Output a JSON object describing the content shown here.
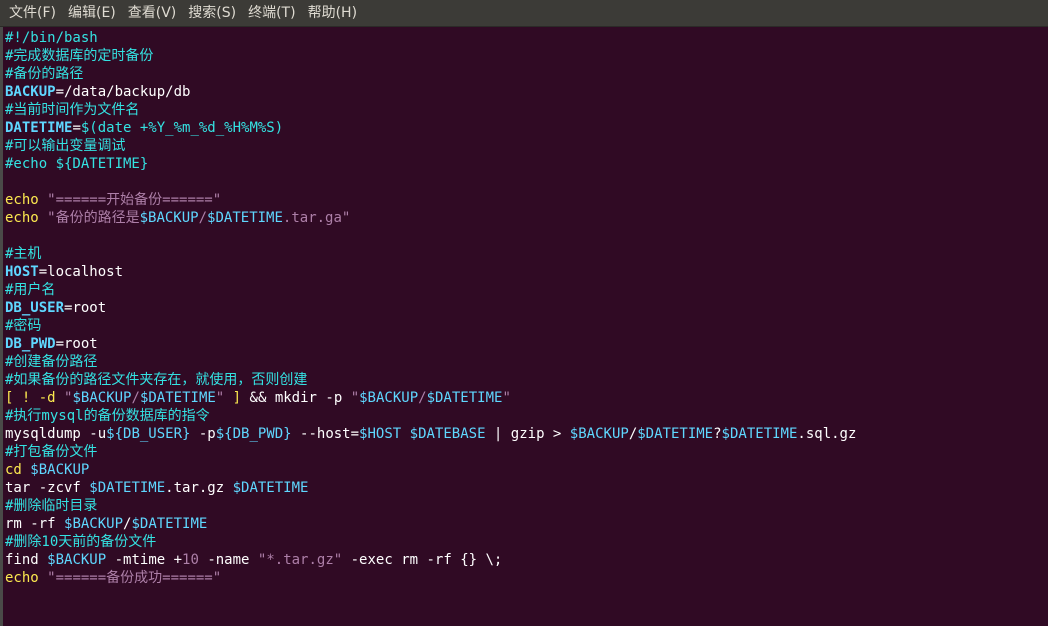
{
  "menu": {
    "items": [
      {
        "label": "文件(F)"
      },
      {
        "label": "编辑(E)"
      },
      {
        "label": "查看(V)"
      },
      {
        "label": "搜索(S)"
      },
      {
        "label": "终端(T)"
      },
      {
        "label": "帮助(H)"
      }
    ]
  },
  "terminal": {
    "colors": {
      "background": "#300a24",
      "comment": "#34e2e2",
      "variable": "#5fd7ff",
      "string": "#ad7fa8",
      "keyword": "#fce94f",
      "text": "#ffffff"
    },
    "lines": [
      [
        [
          "c",
          "#!/bin/bash"
        ]
      ],
      [
        [
          "c",
          "#完成数据库的定时备份"
        ]
      ],
      [
        [
          "c",
          "#备份的路径"
        ]
      ],
      [
        [
          "v",
          "BACKUP"
        ],
        [
          "n",
          "=/data/backup/db"
        ]
      ],
      [
        [
          "c",
          "#当前时间作为文件名"
        ]
      ],
      [
        [
          "v",
          "DATETIME"
        ],
        [
          "n",
          "="
        ],
        [
          "e",
          "$(date +%Y_%m_%d_%H%M%S)"
        ]
      ],
      [
        [
          "c",
          "#可以输出变量调试"
        ]
      ],
      [
        [
          "c",
          "#echo ${DATETIME}"
        ]
      ],
      [],
      [
        [
          "k",
          "echo"
        ],
        [
          "n",
          " "
        ],
        [
          "s",
          "\"======开始备份======\""
        ]
      ],
      [
        [
          "k",
          "echo"
        ],
        [
          "n",
          " "
        ],
        [
          "s",
          "\"备份的路径是"
        ],
        [
          "sv",
          "$BACKUP"
        ],
        [
          "s",
          "/"
        ],
        [
          "sv",
          "$DATETIME"
        ],
        [
          "s",
          ".tar.ga\""
        ]
      ],
      [],
      [
        [
          "c",
          "#主机"
        ]
      ],
      [
        [
          "v",
          "HOST"
        ],
        [
          "n",
          "=localhost"
        ]
      ],
      [
        [
          "c",
          "#用户名"
        ]
      ],
      [
        [
          "v",
          "DB_USER"
        ],
        [
          "n",
          "=root"
        ]
      ],
      [
        [
          "c",
          "#密码"
        ]
      ],
      [
        [
          "v",
          "DB_PWD"
        ],
        [
          "n",
          "=root"
        ]
      ],
      [
        [
          "c",
          "#创建备份路径"
        ]
      ],
      [
        [
          "c",
          "#如果备份的路径文件夹存在，就使用，否则创建"
        ]
      ],
      [
        [
          "k",
          "["
        ],
        [
          "n",
          " "
        ],
        [
          "k",
          "!"
        ],
        [
          "n",
          " "
        ],
        [
          "k",
          "-d"
        ],
        [
          "n",
          " "
        ],
        [
          "s",
          "\""
        ],
        [
          "sv",
          "$BACKUP"
        ],
        [
          "s",
          "/"
        ],
        [
          "sv",
          "$DATETIME"
        ],
        [
          "s",
          "\""
        ],
        [
          "n",
          " "
        ],
        [
          "k",
          "]"
        ],
        [
          "n",
          " && mkdir -p "
        ],
        [
          "s",
          "\""
        ],
        [
          "sv",
          "$BACKUP"
        ],
        [
          "s",
          "/"
        ],
        [
          "sv",
          "$DATETIME"
        ],
        [
          "s",
          "\""
        ]
      ],
      [
        [
          "c",
          "#执行mysql的备份数据库的指令"
        ]
      ],
      [
        [
          "n",
          "mysqldump -u"
        ],
        [
          "sv",
          "${DB_USER}"
        ],
        [
          "n",
          " -p"
        ],
        [
          "sv",
          "${DB_PWD}"
        ],
        [
          "n",
          " --host="
        ],
        [
          "sv",
          "$HOST"
        ],
        [
          "n",
          " "
        ],
        [
          "sv",
          "$DATEBASE"
        ],
        [
          "n",
          " | gzip > "
        ],
        [
          "sv",
          "$BACKUP"
        ],
        [
          "n",
          "/"
        ],
        [
          "sv",
          "$DATETIME"
        ],
        [
          "n",
          "?"
        ],
        [
          "sv",
          "$DATETIME"
        ],
        [
          "n",
          ".sql.gz"
        ]
      ],
      [
        [
          "c",
          "#打包备份文件"
        ]
      ],
      [
        [
          "k",
          "cd"
        ],
        [
          "n",
          " "
        ],
        [
          "sv",
          "$BACKUP"
        ]
      ],
      [
        [
          "n",
          "tar -zcvf "
        ],
        [
          "sv",
          "$DATETIME"
        ],
        [
          "n",
          ".tar.gz "
        ],
        [
          "sv",
          "$DATETIME"
        ]
      ],
      [
        [
          "c",
          "#删除临时目录"
        ]
      ],
      [
        [
          "n",
          "rm -rf "
        ],
        [
          "sv",
          "$BACKUP"
        ],
        [
          "n",
          "/"
        ],
        [
          "sv",
          "$DATETIME"
        ]
      ],
      [
        [
          "c",
          "#删除10天前的备份文件"
        ]
      ],
      [
        [
          "n",
          "find "
        ],
        [
          "sv",
          "$BACKUP"
        ],
        [
          "n",
          " -mtime +"
        ],
        [
          "num",
          "10"
        ],
        [
          "n",
          " -name "
        ],
        [
          "s",
          "\"*.tar.gz\""
        ],
        [
          "n",
          " -exec rm -rf {} \\;"
        ]
      ],
      [
        [
          "k",
          "echo"
        ],
        [
          "n",
          " "
        ],
        [
          "s",
          "\"======备份成功======\""
        ]
      ]
    ]
  }
}
